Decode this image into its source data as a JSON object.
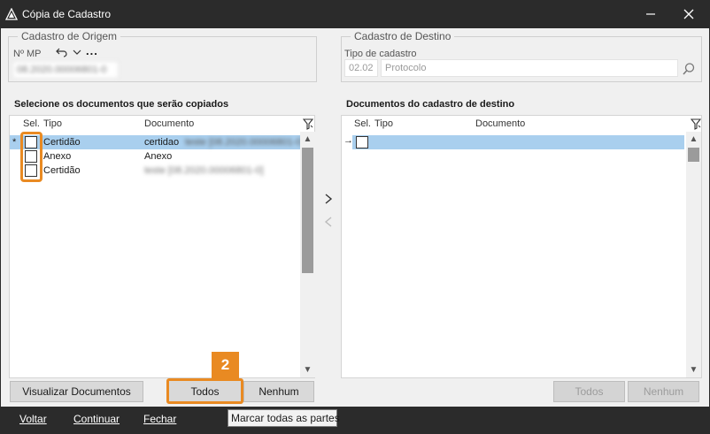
{
  "window": {
    "title": "Cópia de Cadastro",
    "minimize_icon": "minimize-icon",
    "close_icon": "close-icon"
  },
  "origem": {
    "legend": "Cadastro de Origem",
    "mp_label": "Nº MP",
    "mp_value": "08.2020.00006801-0",
    "undo_icon": "undo-icon",
    "chevron_icon": "chevron-down-icon",
    "more_label": "..."
  },
  "destino": {
    "legend": "Cadastro de Destino",
    "tipo_label": "Tipo de cadastro",
    "tipo_code": "02.02",
    "tipo_name": "Protocolo",
    "search_icon": "search-icon"
  },
  "left_panel": {
    "title": "Selecione os documentos que serão copiados",
    "columns": [
      "Sel.",
      "Tipo",
      "Documento"
    ],
    "rows": [
      {
        "marker": "*",
        "tipo": "Certidão",
        "documento": "certidao",
        "extra": "teste [08.2020.00006801-0]",
        "selected": true
      },
      {
        "marker": "",
        "tipo": "Anexo",
        "documento": "Anexo",
        "extra": "",
        "selected": false
      },
      {
        "marker": "",
        "tipo": "Certidão",
        "documento": "",
        "extra": "teste [08.2020.00006801-0]",
        "selected": false
      }
    ]
  },
  "right_panel": {
    "title": "Documentos do cadastro de destino",
    "columns": [
      "Sel.",
      "Tipo",
      "Documento"
    ],
    "row_marker": "→"
  },
  "buttons": {
    "visualizar": "Visualizar Documentos",
    "todos": "Todos",
    "nenhum": "Nenhum",
    "todos_right": "Todos",
    "nenhum_right": "Nenhum"
  },
  "badge": "2",
  "tooltip": "Marcar todas as partes",
  "footer": {
    "voltar": "Voltar",
    "continuar": "Continuar",
    "fechar": "Fechar"
  },
  "colors": {
    "accent": "#e98a22",
    "selection": "#a9cfee",
    "chrome": "#2b2b2b"
  }
}
